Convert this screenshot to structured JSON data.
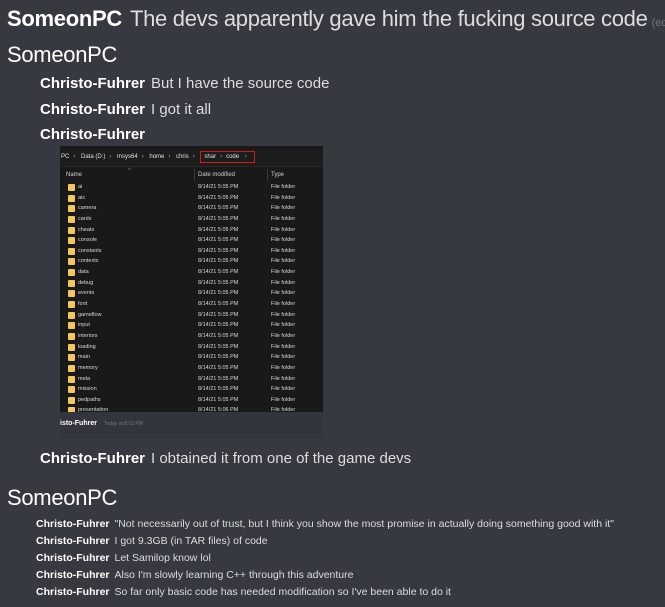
{
  "messages": [
    {
      "author": "SomeonPC",
      "text": "The devs apparently gave him the fucking source code",
      "edited_label": "(edited)"
    },
    {
      "author": "SomeonPC"
    },
    {
      "author": "Christo-Fuhrer",
      "text": "But I have the source code"
    },
    {
      "author": "Christo-Fuhrer",
      "text": "I got it all"
    },
    {
      "author": "Christo-Fuhrer"
    },
    {
      "author": "Christo-Fuhrer",
      "text": "I obtained it from one of the game devs"
    },
    {
      "author": "SomeonPC"
    }
  ],
  "embedded_screenshot": {
    "breadcrumb": [
      "PC",
      "Data (D:)",
      "msys64",
      "home",
      "chris"
    ],
    "breadcrumb_highlighted": [
      "shar",
      "code"
    ],
    "columns": {
      "name": "Name",
      "date": "Date modified",
      "type": "Type"
    },
    "rows": [
      {
        "name": "ai",
        "date": "8/14/21 5:05 PM",
        "type": "File folder"
      },
      {
        "name": "atc",
        "date": "8/14/21 5:05 PM",
        "type": "File folder"
      },
      {
        "name": "camera",
        "date": "8/14/21 5:05 PM",
        "type": "File folder"
      },
      {
        "name": "cards",
        "date": "8/14/21 5:05 PM",
        "type": "File folder"
      },
      {
        "name": "cheats",
        "date": "8/14/21 5:05 PM",
        "type": "File folder"
      },
      {
        "name": "console",
        "date": "8/14/21 5:05 PM",
        "type": "File folder"
      },
      {
        "name": "constants",
        "date": "8/14/21 5:05 PM",
        "type": "File folder"
      },
      {
        "name": "contexts",
        "date": "8/14/21 5:05 PM",
        "type": "File folder"
      },
      {
        "name": "data",
        "date": "8/14/21 5:05 PM",
        "type": "File folder"
      },
      {
        "name": "debug",
        "date": "8/14/21 5:05 PM",
        "type": "File folder"
      },
      {
        "name": "events",
        "date": "8/14/21 5:05 PM",
        "type": "File folder"
      },
      {
        "name": "font",
        "date": "8/14/21 5:05 PM",
        "type": "File folder"
      },
      {
        "name": "gameflow",
        "date": "8/14/21 5:05 PM",
        "type": "File folder"
      },
      {
        "name": "input",
        "date": "8/14/21 5:05 PM",
        "type": "File folder"
      },
      {
        "name": "interiors",
        "date": "8/14/21 5:05 PM",
        "type": "File folder"
      },
      {
        "name": "loading",
        "date": "8/14/21 5:05 PM",
        "type": "File folder"
      },
      {
        "name": "main",
        "date": "8/14/21 5:05 PM",
        "type": "File folder"
      },
      {
        "name": "memory",
        "date": "8/14/21 5:05 PM",
        "type": "File folder"
      },
      {
        "name": "meta",
        "date": "8/14/21 5:05 PM",
        "type": "File folder"
      },
      {
        "name": "mission",
        "date": "8/14/21 5:05 PM",
        "type": "File folder"
      },
      {
        "name": "pedpaths",
        "date": "8/14/21 5:05 PM",
        "type": "File folder"
      },
      {
        "name": "presentation",
        "date": "8/14/21 5:06 PM",
        "type": "File folder"
      }
    ],
    "footer_author": "isto-Fuhrer",
    "footer_time": "Today at 8:53 PM"
  },
  "inner_messages": [
    {
      "author": "Christo-Fuhrer",
      "text": "\"Not necessarily out of trust, but I think you show the most promise in actually doing something good with it\""
    },
    {
      "author": "Christo-Fuhrer",
      "text": "I got 9.3GB (in TAR files) of code"
    },
    {
      "author": "Christo-Fuhrer",
      "text": "Let Samilop know lol"
    },
    {
      "author": "Christo-Fuhrer",
      "text": "Also I'm slowly learning C++ through this adventure"
    },
    {
      "author": "Christo-Fuhrer",
      "text": "So far only basic code has needed modification so I've been able to do it"
    }
  ]
}
